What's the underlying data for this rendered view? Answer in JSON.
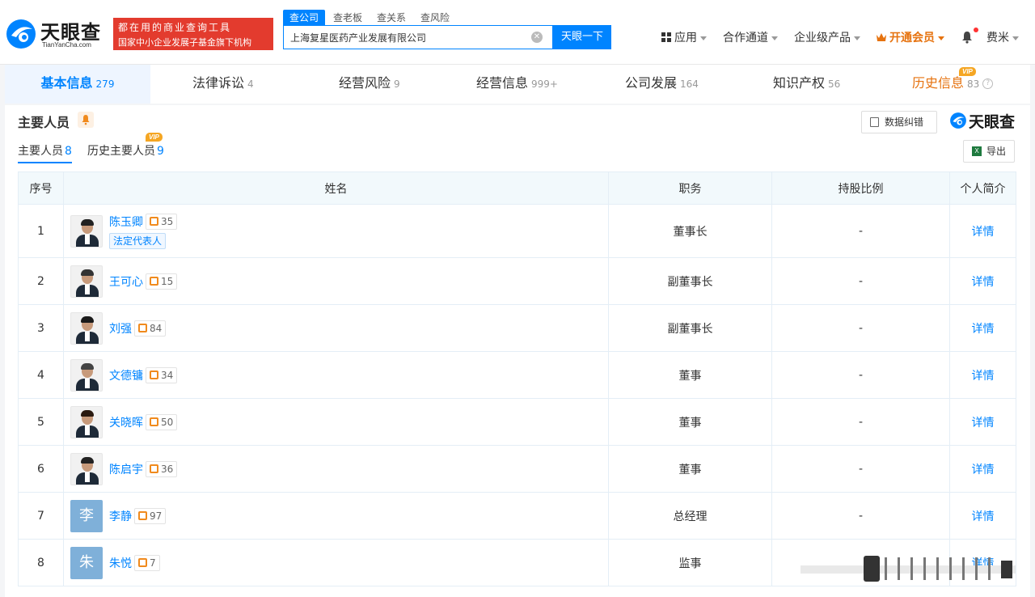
{
  "header": {
    "logo_cn": "天眼查",
    "logo_en": "TianYanCha.com",
    "ad_line1": "都在用的商业查询工具",
    "ad_line2": "国家中小企业发展子基金旗下机构",
    "search_tabs": [
      "查公司",
      "查老板",
      "查关系",
      "查风险"
    ],
    "search_value": "上海复星医药产业发展有限公司",
    "search_button": "天眼一下",
    "nav": {
      "apps": "应用",
      "channel": "合作通道",
      "enterprise": "企业级产品",
      "member": "开通会员",
      "user": "费米"
    }
  },
  "main_tabs": [
    {
      "label": "基本信息",
      "count": "279"
    },
    {
      "label": "法律诉讼",
      "count": "4"
    },
    {
      "label": "经营风险",
      "count": "9"
    },
    {
      "label": "经营信息",
      "count": "999+"
    },
    {
      "label": "公司发展",
      "count": "164"
    },
    {
      "label": "知识产权",
      "count": "56"
    },
    {
      "label": "历史信息",
      "count": "83"
    }
  ],
  "vip_text": "VIP",
  "section": {
    "title": "主要人员",
    "data_correction": "数据纠错",
    "brand": "天眼查",
    "export": "导出",
    "subtabs": [
      {
        "label": "主要人员",
        "count": "8"
      },
      {
        "label": "历史主要人员",
        "count": "9"
      }
    ]
  },
  "table": {
    "headers": [
      "序号",
      "姓名",
      "职务",
      "持股比例",
      "个人简介"
    ],
    "legal_rep_tag": "法定代表人",
    "detail_label": "详情",
    "rows": [
      {
        "no": "1",
        "name": "陈玉卿",
        "relations": "35",
        "title": "董事长",
        "share": "-",
        "avatar_text": ""
      },
      {
        "no": "2",
        "name": "王可心",
        "relations": "15",
        "title": "副董事长",
        "share": "-",
        "avatar_text": ""
      },
      {
        "no": "3",
        "name": "刘强",
        "relations": "84",
        "title": "副董事长",
        "share": "-",
        "avatar_text": ""
      },
      {
        "no": "4",
        "name": "文德镛",
        "relations": "34",
        "title": "董事",
        "share": "-",
        "avatar_text": ""
      },
      {
        "no": "5",
        "name": "关晓晖",
        "relations": "50",
        "title": "董事",
        "share": "-",
        "avatar_text": ""
      },
      {
        "no": "6",
        "name": "陈启宇",
        "relations": "36",
        "title": "董事",
        "share": "-",
        "avatar_text": ""
      },
      {
        "no": "7",
        "name": "李静",
        "relations": "97",
        "title": "总经理",
        "share": "-",
        "avatar_text": "李"
      },
      {
        "no": "8",
        "name": "朱悦",
        "relations": "7",
        "title": "监事",
        "share": "",
        "avatar_text": "朱"
      }
    ]
  },
  "colors": {
    "accent": "#0084ff",
    "vip": "#f5a623",
    "member": "#e6720e",
    "ad_red": "#e33b2e"
  }
}
